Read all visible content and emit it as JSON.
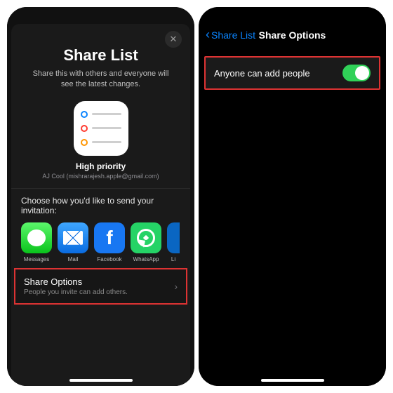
{
  "left": {
    "title": "Share List",
    "description": "Share this with others and everyone will see the latest changes.",
    "list_name": "High priority",
    "list_sub": "AJ Cool (mishrarajesh.apple@gmail.com)",
    "invite_heading": "Choose how you'd like to send your invitation:",
    "apps": {
      "messages": "Messages",
      "mail": "Mail",
      "facebook": "Facebook",
      "whatsapp": "WhatsApp",
      "linkedin": "Li"
    },
    "share_options": {
      "title": "Share Options",
      "sub": "People you invite can add others."
    }
  },
  "right": {
    "back_label": "Share List",
    "nav_title": "Share Options",
    "toggle_label": "Anyone can add people",
    "toggle_on": true
  }
}
